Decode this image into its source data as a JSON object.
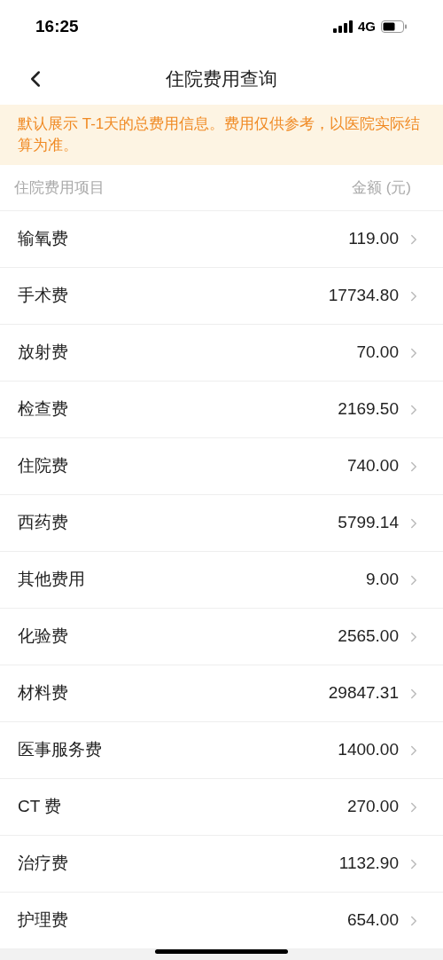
{
  "status_bar": {
    "time": "16:25",
    "network": "4G"
  },
  "nav": {
    "title": "住院费用查询"
  },
  "notice": "默认展示 T-1天的总费用信息。费用仅供参考，以医院实际结算为准。",
  "table": {
    "columns": [
      "住院费用项目",
      "金额 (元)"
    ],
    "rows": [
      {
        "name": "输氧费",
        "amount": "119.00"
      },
      {
        "name": "手术费",
        "amount": "17734.80"
      },
      {
        "name": "放射费",
        "amount": "70.00"
      },
      {
        "name": "检查费",
        "amount": "2169.50"
      },
      {
        "name": "住院费",
        "amount": "740.00"
      },
      {
        "name": "西药费",
        "amount": "5799.14"
      },
      {
        "name": "其他费用",
        "amount": "9.00"
      },
      {
        "name": "化验费",
        "amount": "2565.00"
      },
      {
        "name": "材料费",
        "amount": "29847.31"
      },
      {
        "name": "医事服务费",
        "amount": "1400.00"
      },
      {
        "name": "CT 费",
        "amount": "270.00"
      },
      {
        "name": "治疗费",
        "amount": "1132.90"
      },
      {
        "name": "护理费",
        "amount": "654.00"
      }
    ]
  }
}
